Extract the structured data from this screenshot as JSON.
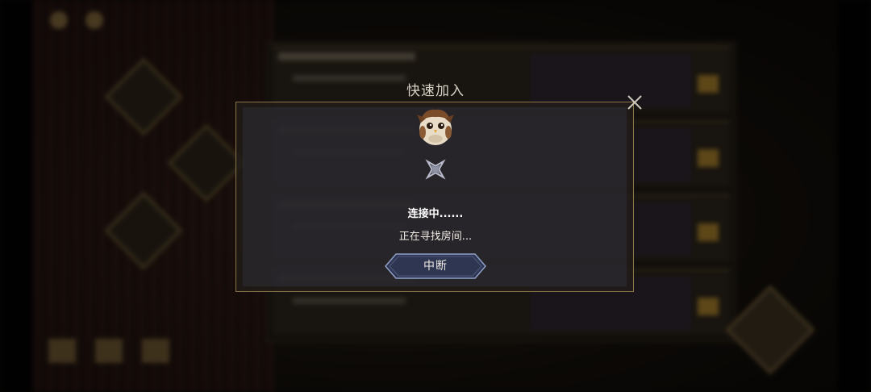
{
  "dialog": {
    "title": "快速加入",
    "status_main": "连接中......",
    "status_sub": "正在寻找房间...",
    "abort_label": "中断"
  },
  "icons": {
    "close": "close-x-icon",
    "mascot": "owl-mascot-icon",
    "spinner": "shuriken-loading-icon"
  },
  "colors": {
    "dialog_border": "#8a7448",
    "button_fill": "#2f3652",
    "button_border": "#8fa0c8"
  }
}
